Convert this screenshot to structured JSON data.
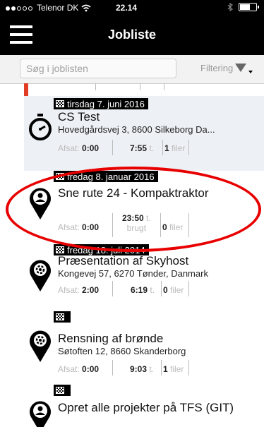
{
  "status_bar": {
    "carrier": "Telenor DK",
    "time": "22.14"
  },
  "nav": {
    "title": "Jobliste"
  },
  "search": {
    "placeholder": "Søg i joblisten",
    "filter_label": "Filtering"
  },
  "jobs": [
    {
      "date": "",
      "title": "",
      "address": "",
      "icon": "pin-icon",
      "afsat": "",
      "tid": "",
      "filer": ""
    },
    {
      "date": "tirsdag 7. juni 2016",
      "title": "CS Test",
      "address": "Hovedgårdsvej 3, 8600 Silkeborg Da...",
      "icon": "stopwatch-icon",
      "afsat_label": "Afsat:",
      "afsat": "0:00",
      "tid": "7:55",
      "tid_unit": "t.",
      "filer": "1",
      "filer_label": "filer"
    },
    {
      "date": "fredag 8. januar 2016",
      "title": "Sne rute 24 - Kompaktraktor",
      "address": "",
      "icon": "person-pin-icon",
      "afsat_label": "Afsat:",
      "afsat": "0:00",
      "tid": "23:50",
      "tid_unit": "t.",
      "tid_sub": "brugt",
      "filer": "0",
      "filer_label": "filer"
    },
    {
      "date": "fredag 18. juli 2014",
      "title": "Præsentation af Skyhost",
      "address": "Kongevej 57, 6270 Tønder, Danmark",
      "icon": "gear-pin-icon",
      "afsat_label": "Afsat:",
      "afsat": "2:00",
      "tid": "6:19",
      "tid_unit": "t.",
      "filer": "0",
      "filer_label": "filer"
    },
    {
      "date": "",
      "title": "Rensning af brønde",
      "address": "Søtoften 12, 8660 Skanderborg",
      "icon": "gear-pin-icon",
      "afsat_label": "Afsat:",
      "afsat": "0:00",
      "tid": "9:03",
      "tid_unit": "t.",
      "filer": "1",
      "filer_label": "filer"
    },
    {
      "date": "",
      "title": "Opret alle projekter på TFS (GIT)",
      "address": "",
      "icon": "person-pin-icon"
    }
  ],
  "colors": {
    "accent_red": "#e03c26",
    "annotation_red": "#e80000",
    "alt_row": "#edf1f5"
  }
}
